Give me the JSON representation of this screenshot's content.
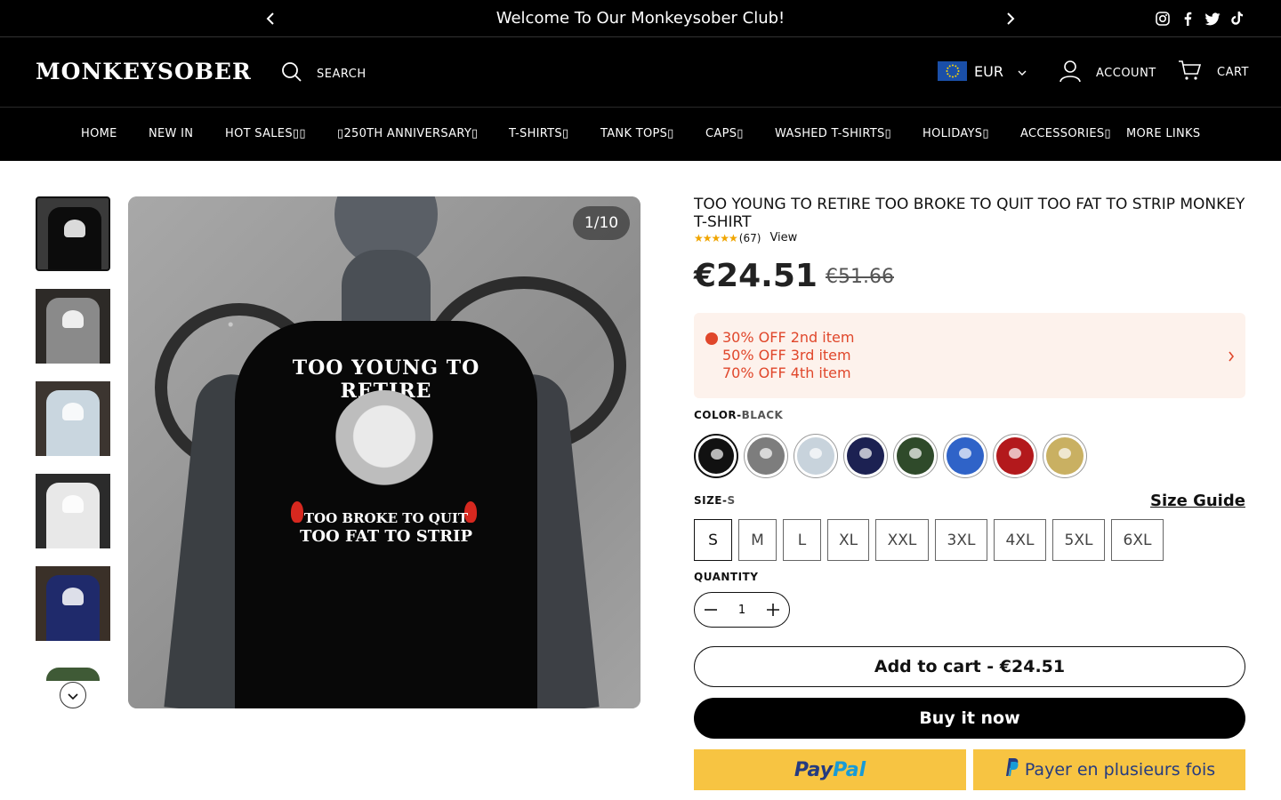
{
  "announcement": {
    "message": "Welcome To Our Monkeysober Club!"
  },
  "header": {
    "logo": "MONKEYSOBER",
    "search_label": "SEARCH",
    "currency": "EUR",
    "account_label": "ACCOUNT",
    "cart_label": "CART"
  },
  "nav": [
    {
      "label": "HOME"
    },
    {
      "label": "NEW IN"
    },
    {
      "label": "HOT SALES▯▯"
    },
    {
      "label": "▯250TH ANNIVERSARY▯"
    },
    {
      "label": "T-SHIRTS▯"
    },
    {
      "label": "TANK TOPS▯"
    },
    {
      "label": "CAPS▯"
    },
    {
      "label": "WASHED T-SHIRTS▯"
    },
    {
      "label": "HOLIDAYS▯"
    },
    {
      "label": "ACCESSORIES▯"
    },
    {
      "label": "MORE LINKS"
    }
  ],
  "gallery": {
    "counter": "1/10",
    "print_line1": "TOO YOUNG TO RETIRE",
    "print_line2": "TOO BROKE TO QUIT",
    "print_line3": "TOO FAT TO STRIP",
    "thumb_colors": [
      "#0c0c0c",
      "#8a8a8a",
      "#c9d6df",
      "#e8e8e8",
      "#1f2a6b",
      "#3f5a36"
    ]
  },
  "product": {
    "title": "TOO YOUNG TO RETIRE TOO BROKE TO QUIT TOO FAT TO STRIP MONKEY T-SHIRT",
    "stars": "★★★★★",
    "review_count": "(67)",
    "view_label": "View",
    "price": "€24.51",
    "compare_price": "€51.66",
    "promo": [
      "30% OFF 2nd item",
      "50% OFF 3rd item",
      "70% OFF 4th item"
    ],
    "color_label": "COLOR-",
    "color_value": "BLACK",
    "colors": [
      {
        "name": "Black",
        "hex": "#111111"
      },
      {
        "name": "Gray",
        "hex": "#7d7d7d"
      },
      {
        "name": "Light Blue",
        "hex": "#c8d3dc"
      },
      {
        "name": "Navy",
        "hex": "#1c2152"
      },
      {
        "name": "Army Green",
        "hex": "#2f4a2a"
      },
      {
        "name": "Blue",
        "hex": "#2f63c8"
      },
      {
        "name": "Red",
        "hex": "#b3191c"
      },
      {
        "name": "Yellow",
        "hex": "#c9b062"
      }
    ],
    "size_label": "SIZE-",
    "size_value": "S",
    "size_guide": "Size Guide",
    "sizes": [
      "S",
      "M",
      "L",
      "XL",
      "XXL",
      "3XL",
      "4XL",
      "5XL",
      "6XL"
    ],
    "quantity_label": "QUANTITY",
    "quantity": "1",
    "add_to_cart": "Add to cart - €24.51",
    "buy_now": "Buy it now",
    "paypal_pay": "Pay",
    "paypal_pal": "Pal",
    "paylater": "Payer en plusieurs fois"
  },
  "colors": {
    "promo_text": "#e0472b",
    "promo_bg": "#fdf2ec",
    "paypal_yellow": "#f7c442",
    "star": "#f0a500"
  }
}
